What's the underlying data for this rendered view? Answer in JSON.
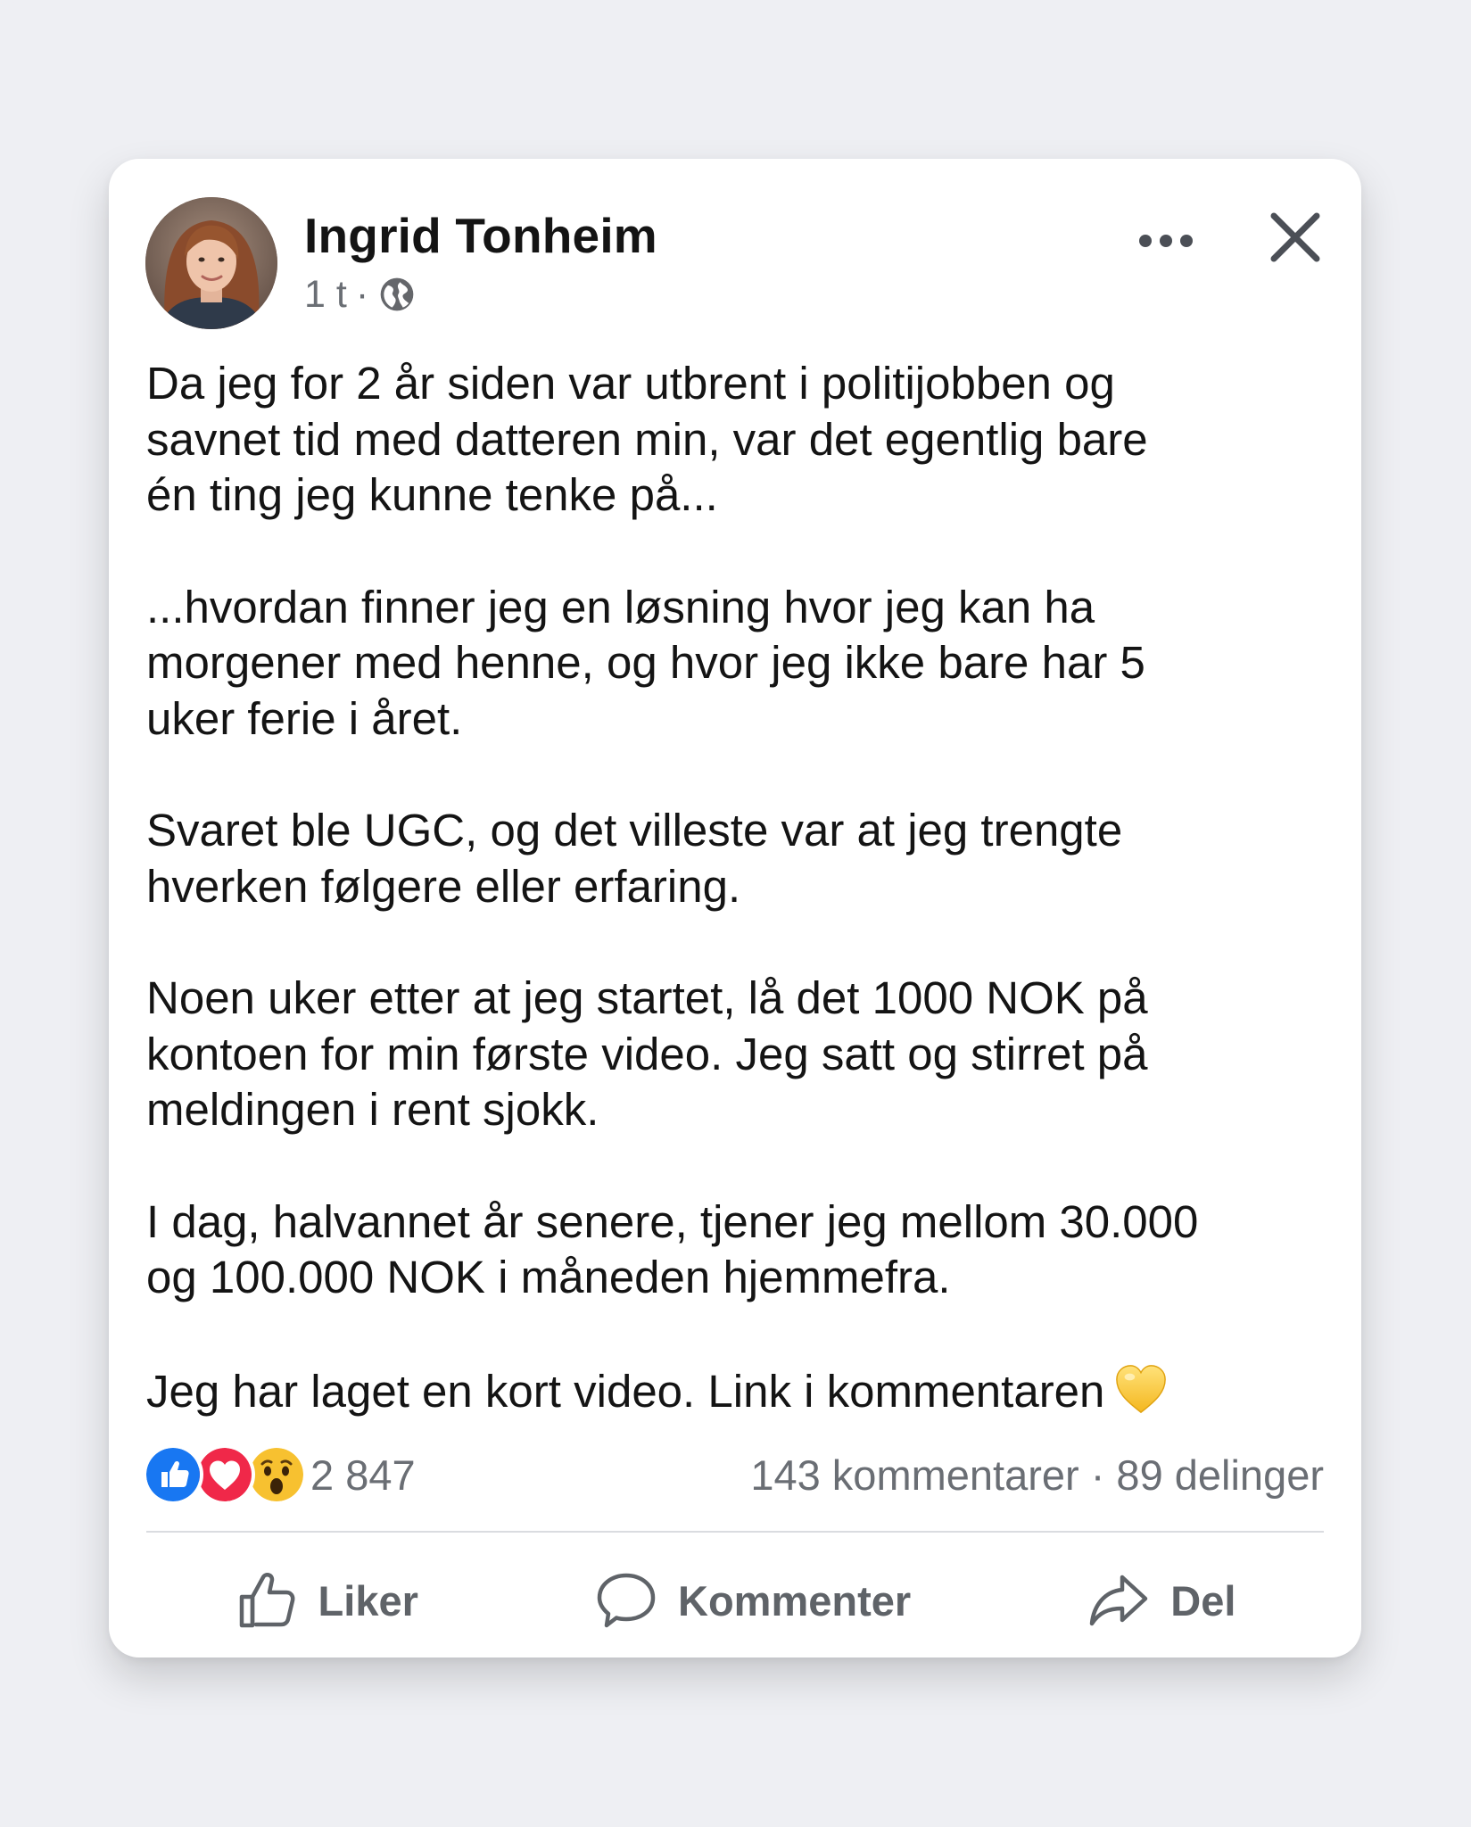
{
  "post": {
    "author": {
      "name": "Ingrid Tonheim",
      "avatar": "avatar-photo-woman"
    },
    "meta": {
      "time": "1 t",
      "separator": "·",
      "audience_icon": "globe-icon"
    },
    "header_icons": {
      "more": "more-horizontal-icon",
      "close": "close-icon"
    },
    "paragraphs": [
      "Da jeg for 2 år siden var utbrent i politijobben og\nsavnet tid med datteren min, var det egentlig bare\nén ting jeg kunne tenke på...",
      "...hvordan finner jeg en løsning hvor jeg kan ha\nmorgener med henne, og hvor jeg ikke bare har 5\nuker ferie i året.",
      "Svaret ble UGC, og det villeste var at jeg trengte\nhverken følgere eller erfaring.",
      "Noen uker etter at jeg startet, lå det 1000 NOK på\nkontoen for min første video. Jeg satt og stirret på\nmeldingen i rent sjokk.",
      "I dag, halvannet år senere, tjener jeg mellom 30.000\nog 100.000 NOK i måneden hjemmefra."
    ],
    "closing_line": "Jeg har laget en kort video. Link i kommentaren",
    "closing_emoji": "yellow-heart-icon",
    "reactions": {
      "icons": [
        "like-reaction-icon",
        "love-reaction-icon",
        "wow-reaction-icon"
      ],
      "count": "2 847"
    },
    "engagement": "143 kommentarer · 89 delinger",
    "actions": [
      {
        "label": "Liker",
        "icon": "thumbs-up-icon"
      },
      {
        "label": "Kommenter",
        "icon": "comment-bubble-icon"
      },
      {
        "label": "Del",
        "icon": "share-arrow-icon"
      }
    ],
    "colors": {
      "like_blue": "#1877f2",
      "love_red": "#f02849",
      "wow_yellow": "#f7c130",
      "text_secondary": "#65676b"
    }
  }
}
